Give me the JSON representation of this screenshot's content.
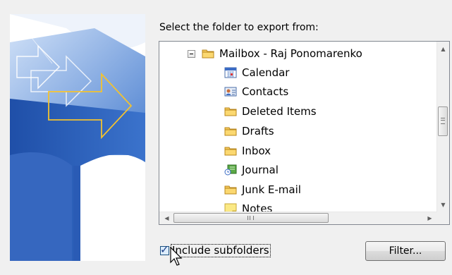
{
  "prompt": "Select the folder to export from:",
  "tree": {
    "root": {
      "label": "Mailbox - Raj Ponomarenko",
      "icon": "folder-icon",
      "expanded": true
    },
    "children": [
      {
        "label": "Calendar",
        "icon": "calendar-icon"
      },
      {
        "label": "Contacts",
        "icon": "contacts-icon"
      },
      {
        "label": "Deleted Items",
        "icon": "folder-icon"
      },
      {
        "label": "Drafts",
        "icon": "folder-icon"
      },
      {
        "label": "Inbox",
        "icon": "folder-icon"
      },
      {
        "label": "Journal",
        "icon": "journal-icon"
      },
      {
        "label": "Junk E-mail",
        "icon": "folder-icon"
      },
      {
        "label": "Notes",
        "icon": "notes-icon"
      }
    ]
  },
  "include_subfolders": {
    "label": "Include subfolders",
    "checked": true
  },
  "filter_button": {
    "label": "Filter..."
  },
  "colors": {
    "folder": "#f4c85a",
    "art_blue": "#2c5fb8",
    "art_arrow": "#f2c230",
    "border": "#828790"
  }
}
